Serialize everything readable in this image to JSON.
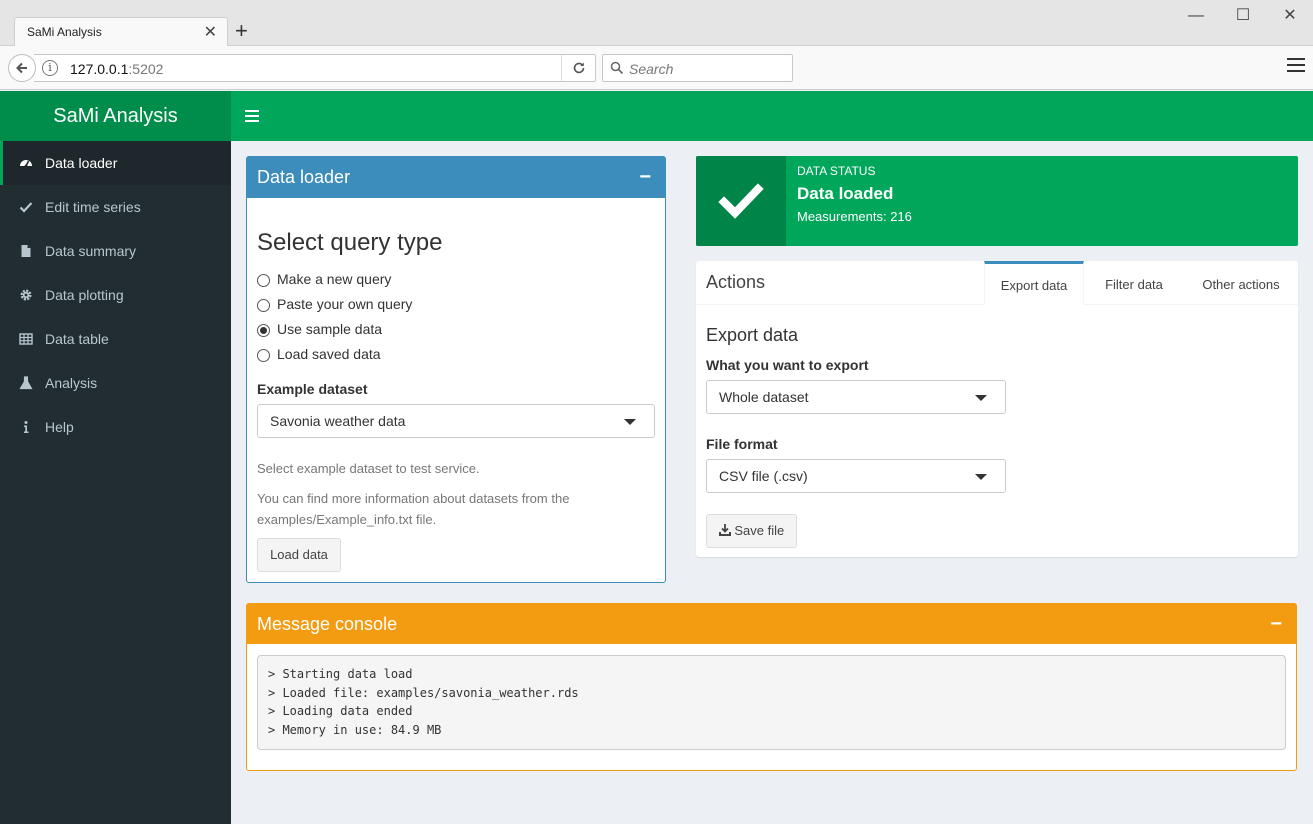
{
  "browser": {
    "tab_title": "SaMi Analysis",
    "tab_close": "✕",
    "new_tab": "+",
    "url_host": "127.0.0.1",
    "url_port": ":5202",
    "search_placeholder": "Search",
    "window_controls": {
      "minimize": "—",
      "maximize": "☐",
      "close": "✕"
    }
  },
  "app": {
    "logo": "SaMi Analysis",
    "accent_color": "#00a65a",
    "primary_color": "#3c8dbc",
    "warning_color": "#f39c12"
  },
  "sidebar": {
    "items": [
      {
        "label": "Data loader",
        "icon": "dashboard-icon",
        "active": true
      },
      {
        "label": "Edit time series",
        "icon": "check-icon"
      },
      {
        "label": "Data summary",
        "icon": "file-icon"
      },
      {
        "label": "Data plotting",
        "icon": "gear-icon"
      },
      {
        "label": "Data table",
        "icon": "table-icon"
      },
      {
        "label": "Analysis",
        "icon": "flask-icon"
      },
      {
        "label": "Help",
        "icon": "info-icon"
      }
    ]
  },
  "loader": {
    "header": "Data loader",
    "collapse": "−",
    "query_title": "Select query type",
    "options": [
      {
        "label": "Make a new query",
        "checked": false
      },
      {
        "label": "Paste your own query",
        "checked": false
      },
      {
        "label": "Use sample data",
        "checked": true
      },
      {
        "label": "Load saved data",
        "checked": false
      }
    ],
    "dataset_label": "Example dataset",
    "dataset_value": "Savonia weather data",
    "help1": "Select example dataset to test service.",
    "help2": "You can find more information about datasets from the examples/Example_info.txt file.",
    "load_button": "Load data"
  },
  "status": {
    "label": "Data status",
    "value": "Data loaded",
    "sub": "Measurements: 216",
    "icon": "checkmark-icon"
  },
  "actions": {
    "title": "Actions",
    "tabs": [
      "Export data",
      "Filter data",
      "Other actions"
    ],
    "active_tab": "Export data",
    "export_title": "Export data",
    "what_label": "What you want to export",
    "what_value": "Whole dataset",
    "format_label": "File format",
    "format_value": "CSV file (.csv)",
    "save_button": "Save file"
  },
  "console": {
    "header": "Message console",
    "collapse": "−",
    "lines": [
      "> Starting data load",
      "> Loaded file: examples/savonia_weather.rds",
      "> Loading data ended",
      "> Memory in use: 84.9 MB"
    ]
  }
}
